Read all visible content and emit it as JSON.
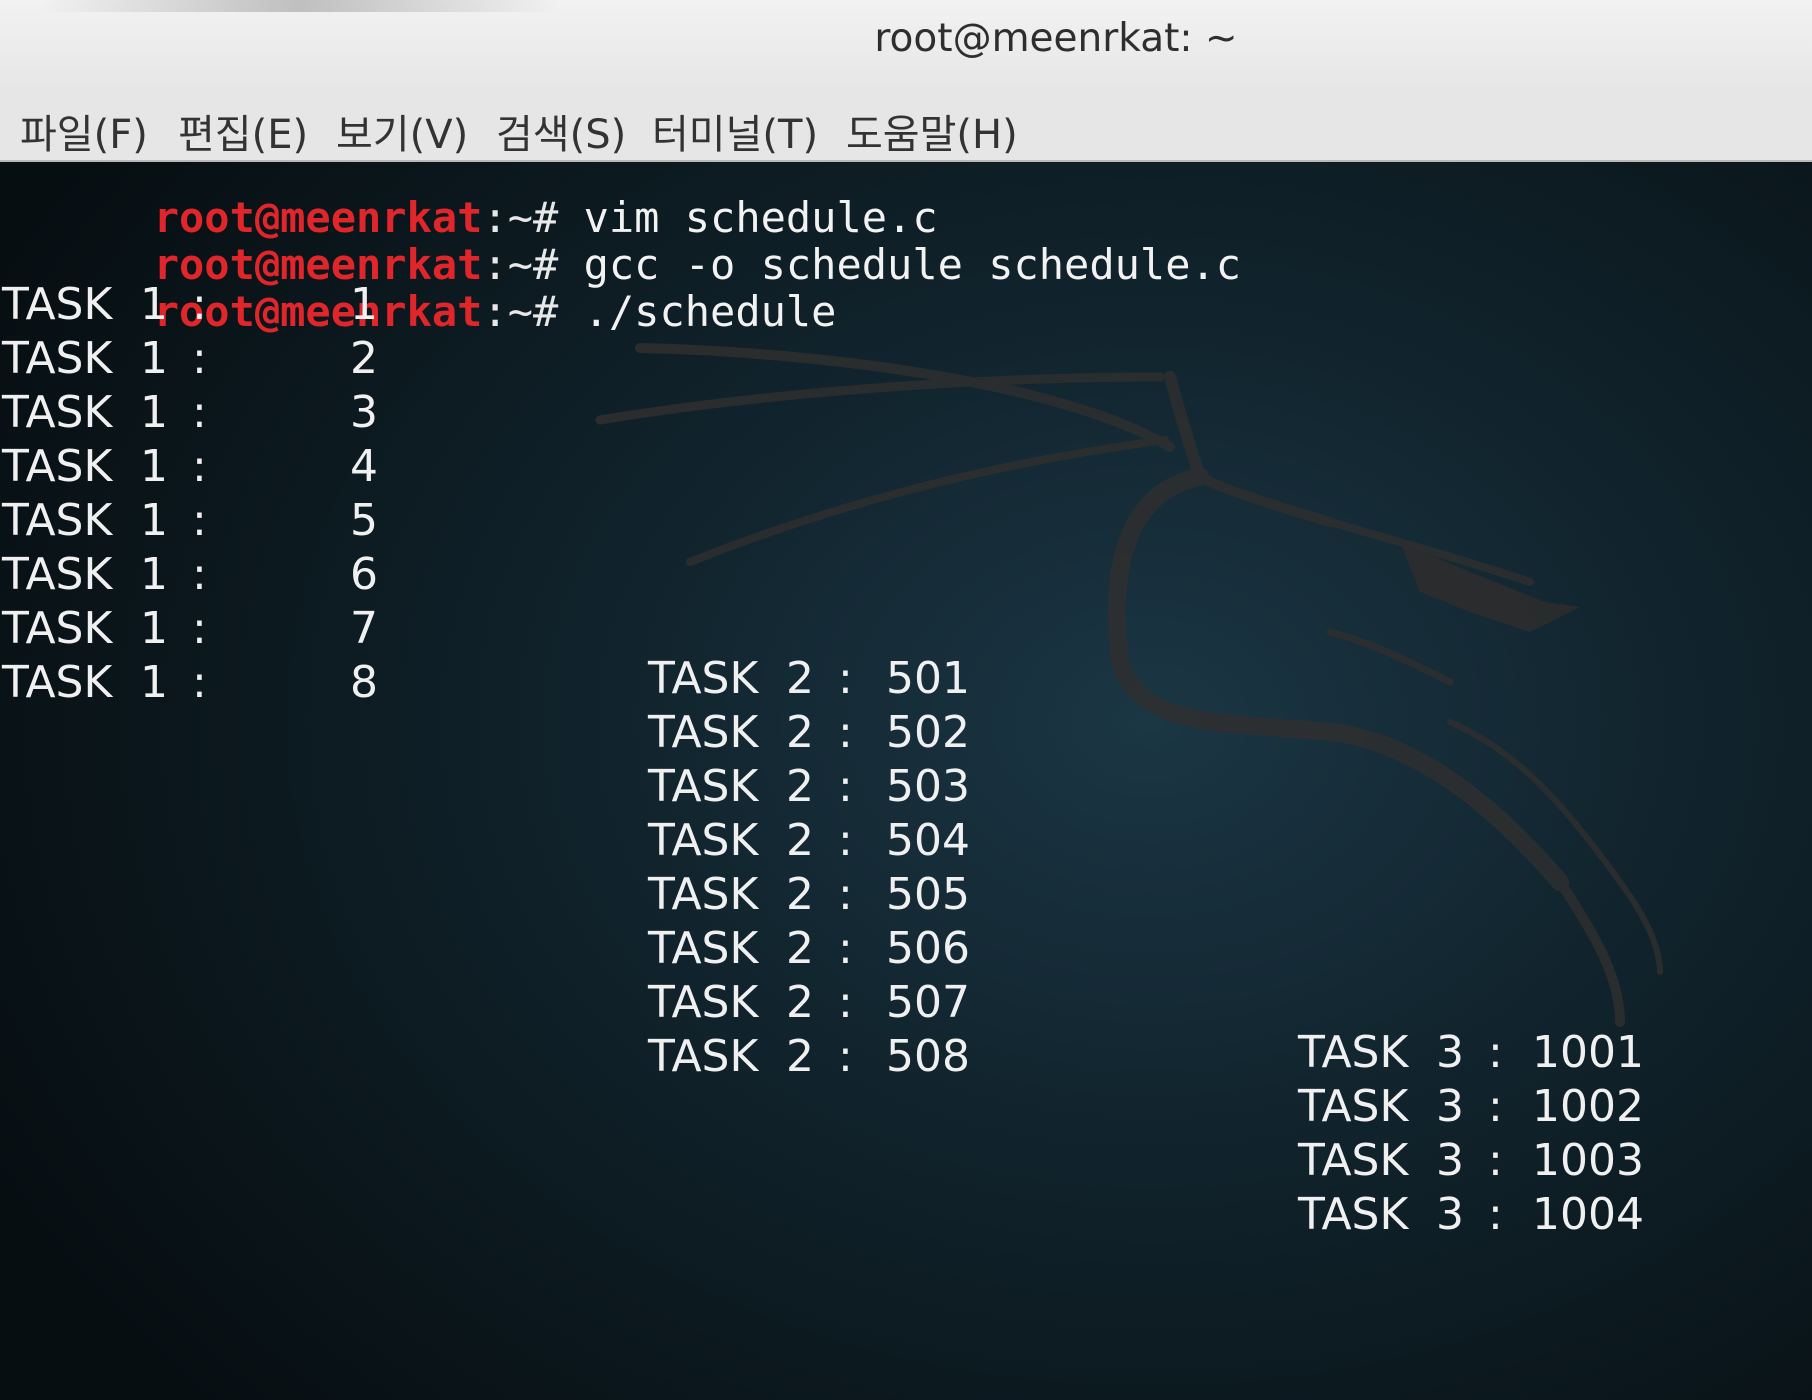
{
  "window": {
    "title": "root@meenrkat: ~"
  },
  "menu": [
    "파일(F)",
    "편집(E)",
    "보기(V)",
    "검색(S)",
    "터미널(T)",
    "도움말(H)"
  ],
  "prompts": [
    {
      "user": "root@meenrkat",
      "sep": ":",
      "path": "~# ",
      "command": "vim schedule.c"
    },
    {
      "user": "root@meenrkat",
      "sep": ":",
      "path": "~# ",
      "command": "gcc -o schedule schedule.c"
    },
    {
      "user": "root@meenrkat",
      "sep": ":",
      "path": "~# ",
      "command": "./schedule"
    }
  ],
  "task1": {
    "label": "TASK",
    "num": "1",
    "colon": ":",
    "values": [
      "1",
      "2",
      "3",
      "4",
      "5",
      "6",
      "7",
      "8"
    ]
  },
  "task2": {
    "label": "TASK",
    "num": "2",
    "colon": ":",
    "values": [
      "501",
      "502",
      "503",
      "504",
      "505",
      "506",
      "507",
      "508"
    ]
  },
  "task3": {
    "label": "TASK",
    "num": "3",
    "colon": ":",
    "values": [
      "1001",
      "1002",
      "1003",
      "1004"
    ]
  },
  "colors": {
    "prompt_user": "#e0262a",
    "background": "#10222b",
    "text": "#e8e8e8"
  },
  "background_logo": "kali-dragon-icon"
}
